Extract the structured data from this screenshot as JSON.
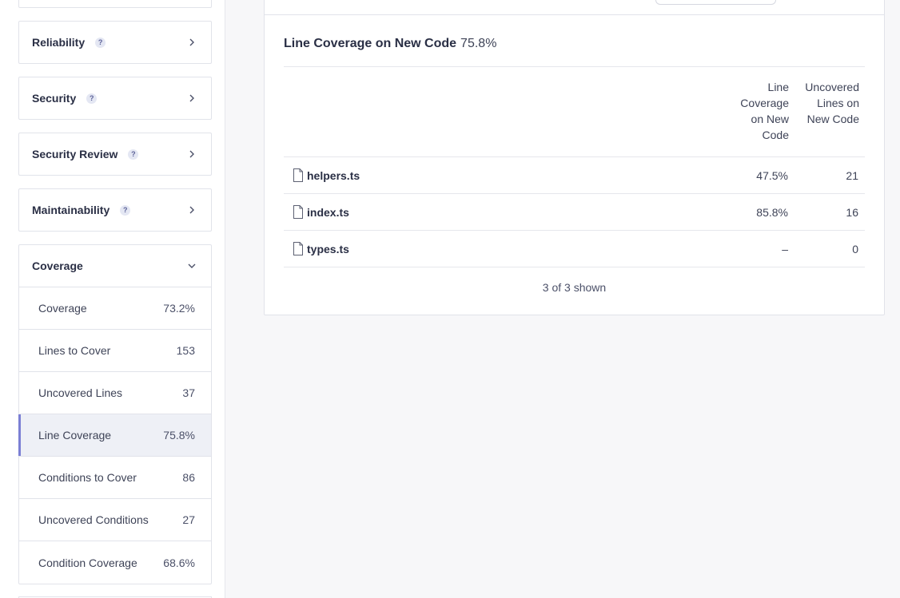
{
  "sidebar": {
    "categories": [
      {
        "label": "Reliability",
        "help": "?"
      },
      {
        "label": "Security",
        "help": "?"
      },
      {
        "label": "Security Review",
        "help": "?"
      },
      {
        "label": "Maintainability",
        "help": "?"
      }
    ],
    "coverage": {
      "label": "Coverage",
      "metrics": [
        {
          "label": "Coverage",
          "value": "73.2%"
        },
        {
          "label": "Lines to Cover",
          "value": "153"
        },
        {
          "label": "Uncovered Lines",
          "value": "37"
        },
        {
          "label": "Line Coverage",
          "value": "75.8%",
          "selected": true
        },
        {
          "label": "Conditions to Cover",
          "value": "86"
        },
        {
          "label": "Uncovered Conditions",
          "value": "27"
        },
        {
          "label": "Condition Coverage",
          "value": "68.6%"
        }
      ]
    }
  },
  "main": {
    "title": "Line Coverage on New Code",
    "title_value": "75.8%",
    "columns": [
      {
        "lines": [
          "Line",
          "Coverage",
          "on New",
          "Code"
        ]
      },
      {
        "lines": [
          "Uncovered",
          "Lines on",
          "New Code"
        ]
      }
    ],
    "rows": [
      {
        "name": "helpers.ts",
        "line_coverage": "47.5%",
        "uncovered_lines": "21"
      },
      {
        "name": "index.ts",
        "line_coverage": "85.8%",
        "uncovered_lines": "16"
      },
      {
        "name": "types.ts",
        "line_coverage": "–",
        "uncovered_lines": "0"
      }
    ],
    "shown": "3 of 3 shown"
  },
  "icons": {
    "category_chevron": "chevron-right-icon",
    "coverage_chevron": "chevron-down-icon",
    "file": "file-icon",
    "help": "help-icon"
  },
  "colors": {
    "accent": "#7b7fd4",
    "selected_bg": "#eef0f6",
    "help_badge_bg": "#e4e7f3",
    "help_badge_fg": "#5d6399"
  }
}
